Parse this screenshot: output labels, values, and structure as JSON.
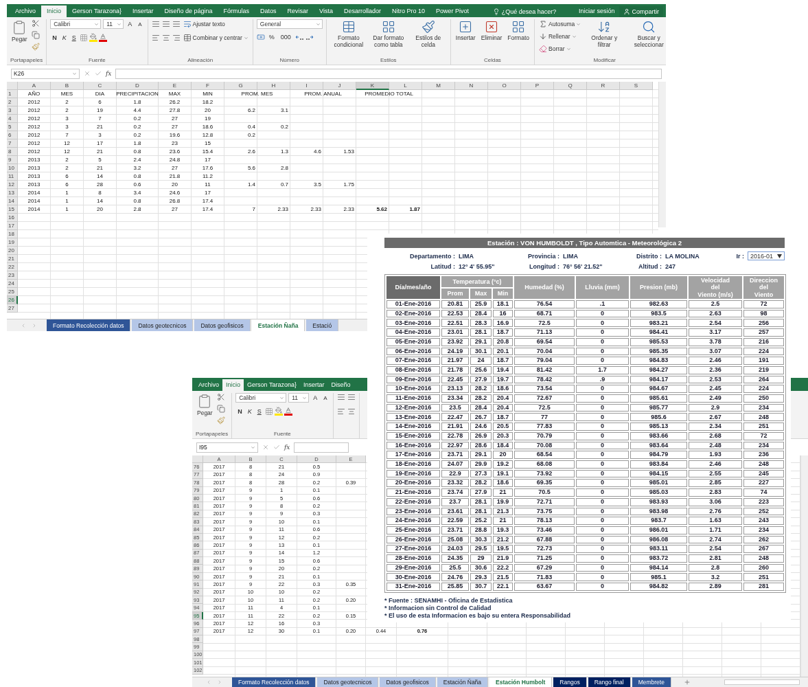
{
  "excel_window_top": {
    "ribbon_tabs": [
      {
        "label": "Archivo",
        "selected": false
      },
      {
        "label": "Inicio",
        "selected": true
      },
      {
        "label": "Gerson Tarazona}",
        "selected": false
      },
      {
        "label": "Insertar",
        "selected": false
      },
      {
        "label": "Diseño de página",
        "selected": false
      },
      {
        "label": "Fórmulas",
        "selected": false
      },
      {
        "label": "Datos",
        "selected": false
      },
      {
        "label": "Revisar",
        "selected": false
      },
      {
        "label": "Vista",
        "selected": false
      },
      {
        "label": "Desarrollador",
        "selected": false
      },
      {
        "label": "Nitro Pro 10",
        "selected": false
      },
      {
        "label": "Power Pivot",
        "selected": false
      }
    ],
    "tell_me": "¿Qué desea hacer?",
    "sign_in": "Iniciar sesión",
    "share": "Compartir",
    "ribbon": [
      {
        "kind": "clipboard",
        "name": "Portapapeles",
        "paste": "Pegar"
      },
      {
        "kind": "font",
        "name": "Fuente",
        "font": "Calibri",
        "size": "11",
        "grow": "A",
        "shrink": "A",
        "styles": [
          "N",
          "K",
          "S"
        ]
      },
      {
        "kind": "alignment",
        "name": "Alineación",
        "wrap": "Ajustar texto",
        "merge": "Combinar y centrar"
      },
      {
        "kind": "number",
        "name": "Número",
        "format": "General",
        "symbols": [
          "%",
          "000"
        ]
      },
      {
        "kind": "styles",
        "name": "Estilos",
        "buttons": [
          "Formato condicional",
          "Dar formato como tabla",
          "Estilos de celda"
        ]
      },
      {
        "kind": "cells",
        "name": "Celdas",
        "buttons": [
          "Insertar",
          "Eliminar",
          "Formato"
        ]
      },
      {
        "kind": "editing",
        "name": "Modificar",
        "small": [
          "Autosuma",
          "Rellenar",
          "Borrar"
        ],
        "large": [
          "Ordenar y filtrar",
          "Buscar y seleccionar"
        ]
      }
    ],
    "name_box": "K26",
    "formula_label": "fx",
    "columns": [
      {
        "label": "A",
        "selected": false
      },
      {
        "label": "B",
        "selected": false
      },
      {
        "label": "C",
        "selected": false
      },
      {
        "label": "D",
        "selected": false
      },
      {
        "label": "E",
        "selected": false
      },
      {
        "label": "F",
        "selected": false
      },
      {
        "label": "G",
        "selected": false
      },
      {
        "label": "H",
        "selected": false
      },
      {
        "label": "I",
        "selected": false
      },
      {
        "label": "J",
        "selected": false
      },
      {
        "label": "K",
        "selected": true
      },
      {
        "label": "L",
        "selected": false
      },
      {
        "label": "M",
        "selected": false
      },
      {
        "label": "N",
        "selected": false
      },
      {
        "label": "O",
        "selected": false
      },
      {
        "label": "P",
        "selected": false
      },
      {
        "label": "Q",
        "selected": false
      },
      {
        "label": "R",
        "selected": false
      },
      {
        "label": "S",
        "selected": false
      }
    ],
    "rows": [
      {
        "num": "1",
        "selected": false,
        "merged": true,
        "cells": [
          "AÑO",
          "MES",
          "DIA",
          "PRECIPITACION",
          "MAX",
          "MIN",
          "PROM. MES",
          null,
          "PROM. ANUAL",
          null,
          "PROMEDIO TOTAL"
        ]
      },
      {
        "num": "2",
        "selected": false,
        "cells": [
          "2012",
          "2",
          "6",
          "1.8",
          "26.2",
          "18.2"
        ]
      },
      {
        "num": "3",
        "selected": false,
        "cells": [
          "2012",
          "2",
          "19",
          "4.4",
          "27.8",
          "20",
          "6.2",
          "3.1"
        ]
      },
      {
        "num": "4",
        "selected": false,
        "cells": [
          "2012",
          "3",
          "7",
          "0.2",
          "27",
          "19"
        ]
      },
      {
        "num": "5",
        "selected": false,
        "cells": [
          "2012",
          "3",
          "21",
          "0.2",
          "27",
          "18.6",
          "0.4",
          "0.2"
        ]
      },
      {
        "num": "6",
        "selected": false,
        "cells": [
          "2012",
          "7",
          "3",
          "0.2",
          "19.6",
          "12.8",
          "0.2"
        ]
      },
      {
        "num": "7",
        "selected": false,
        "cells": [
          "2012",
          "12",
          "17",
          "1.8",
          "23",
          "15"
        ]
      },
      {
        "num": "8",
        "selected": false,
        "cells": [
          "2012",
          "12",
          "21",
          "0.8",
          "23.6",
          "15.4",
          "2.6",
          "1.3",
          "4.6",
          "1.53"
        ]
      },
      {
        "num": "9",
        "selected": false,
        "cells": [
          "2013",
          "2",
          "5",
          "2.4",
          "24.8",
          "17"
        ]
      },
      {
        "num": "10",
        "selected": false,
        "cells": [
          "2013",
          "2",
          "21",
          "3.2",
          "27",
          "17.6",
          "5.6",
          "2.8"
        ]
      },
      {
        "num": "11",
        "selected": false,
        "cells": [
          "2013",
          "6",
          "14",
          "0.8",
          "21.8",
          "11.2"
        ]
      },
      {
        "num": "12",
        "selected": false,
        "cells": [
          "2013",
          "6",
          "28",
          "0.6",
          "20",
          "11",
          "1.4",
          "0.7",
          "3.5",
          "1.75"
        ]
      },
      {
        "num": "13",
        "selected": false,
        "cells": [
          "2014",
          "1",
          "8",
          "3.4",
          "24.6",
          "17"
        ]
      },
      {
        "num": "14",
        "selected": false,
        "cells": [
          "2014",
          "1",
          "14",
          "0.8",
          "26.8",
          "17.4"
        ]
      },
      {
        "num": "15",
        "selected": false,
        "cells": [
          "2014",
          "1",
          "20",
          "2.8",
          "27",
          "17.4",
          "7",
          "2.33",
          "2.33",
          "2.33",
          {
            "text": "5.62",
            "bold": true
          },
          {
            "text": "1.87",
            "bold": true
          }
        ]
      },
      {
        "num": "16",
        "selected": false
      },
      {
        "num": "17",
        "selected": false
      },
      {
        "num": "18",
        "selected": false
      },
      {
        "num": "19",
        "selected": false
      },
      {
        "num": "20",
        "selected": false
      },
      {
        "num": "21",
        "selected": false
      },
      {
        "num": "22",
        "selected": false
      },
      {
        "num": "23",
        "selected": false
      },
      {
        "num": "24",
        "selected": false
      },
      {
        "num": "25",
        "selected": false
      },
      {
        "num": "26",
        "selected": true
      },
      {
        "num": "27",
        "selected": false
      }
    ],
    "sheet_tabs": [
      {
        "label": "Formato Recolección datos",
        "selected": false,
        "color": "#2f5597"
      },
      {
        "label": "Datos geotecnicos",
        "selected": false,
        "color": "#b4c6e7"
      },
      {
        "label": "Datos geofisicos",
        "selected": false,
        "color": "#b4c6e7"
      },
      {
        "label": "Estación Ñaña",
        "selected": true
      },
      {
        "label": "Estació",
        "selected": false,
        "color": "#b4c6e7"
      }
    ]
  },
  "station_report": {
    "title": "Estación : VON HUMBOLDT , Tipo Automtica - Meteorológica 2",
    "info": [
      [
        {
          "label": "Departamento :",
          "value": "LIMA"
        },
        {
          "label": "Provincia :",
          "value": "LIMA"
        },
        {
          "label": "Distrito :",
          "value": "LA MOLINA"
        }
      ],
      [
        {
          "label": "Latitud :",
          "value": "12° 4' 55.95\""
        },
        {
          "label": "Longitud :",
          "value": "76° 56' 21.52\""
        },
        {
          "label": "Altitud :",
          "value": "247"
        }
      ]
    ],
    "go_to": {
      "label": "Ir :",
      "value": "2016-01"
    },
    "columns": [
      {
        "label": "Día/mes/año"
      },
      {
        "label": "Temperatura (°c)",
        "colspan": 3,
        "sub": [
          "Prom",
          "Max",
          "Min"
        ]
      },
      {
        "label": "Humedad (%)"
      },
      {
        "label": "Lluvia (mm)"
      },
      {
        "label": "Presion (mb)"
      },
      {
        "label": "Velocidad\ndel\nViento (m/s)"
      },
      {
        "label": "Direccion\ndel\nViento"
      }
    ],
    "rows": [
      [
        "01-Ene-2016",
        "20.81",
        "25.9",
        "18.1",
        "76.54",
        ".1",
        "982.63",
        "2.5",
        "72"
      ],
      [
        "02-Ene-2016",
        "22.53",
        "28.4",
        "16",
        "68.71",
        "0",
        "983.5",
        "2.63",
        "98"
      ],
      [
        "03-Ene-2016",
        "22.51",
        "28.3",
        "16.9",
        "72.5",
        "0",
        "983.21",
        "2.54",
        "256"
      ],
      [
        "04-Ene-2016",
        "23.01",
        "28.1",
        "18.7",
        "71.13",
        "0",
        "984.41",
        "3.17",
        "257"
      ],
      [
        "05-Ene-2016",
        "23.92",
        "29.1",
        "20.8",
        "69.54",
        "0",
        "985.53",
        "3.78",
        "216"
      ],
      [
        "06-Ene-2016",
        "24.19",
        "30.1",
        "20.1",
        "70.04",
        "0",
        "985.35",
        "3.07",
        "224"
      ],
      [
        "07-Ene-2016",
        "21.97",
        "24",
        "18.7",
        "79.04",
        "0",
        "984.83",
        "2.46",
        "191"
      ],
      [
        "08-Ene-2016",
        "21.78",
        "25.6",
        "19.4",
        "81.42",
        "1.7",
        "984.27",
        "2.36",
        "219"
      ],
      [
        "09-Ene-2016",
        "22.45",
        "27.9",
        "19.7",
        "78.42",
        ".9",
        "984.17",
        "2.53",
        "264"
      ],
      [
        "10-Ene-2016",
        "23.13",
        "28.2",
        "18.6",
        "73.54",
        "0",
        "984.67",
        "2.45",
        "224"
      ],
      [
        "11-Ene-2016",
        "23.34",
        "28.2",
        "20.4",
        "72.67",
        "0",
        "985.61",
        "2.49",
        "250"
      ],
      [
        "12-Ene-2016",
        "23.5",
        "28.4",
        "20.4",
        "72.5",
        "0",
        "985.77",
        "2.9",
        "234"
      ],
      [
        "13-Ene-2016",
        "22.47",
        "26.7",
        "18.7",
        "77",
        "0",
        "985.6",
        "2.67",
        "248"
      ],
      [
        "14-Ene-2016",
        "21.91",
        "24.6",
        "20.5",
        "77.83",
        "0",
        "985.13",
        "2.34",
        "251"
      ],
      [
        "15-Ene-2016",
        "22.78",
        "26.9",
        "20.3",
        "70.79",
        "0",
        "983.66",
        "2.68",
        "72"
      ],
      [
        "16-Ene-2016",
        "22.97",
        "28.6",
        "18.4",
        "70.08",
        "0",
        "983.64",
        "2.48",
        "234"
      ],
      [
        "17-Ene-2016",
        "23.71",
        "29.1",
        "20",
        "68.54",
        "0",
        "984.79",
        "1.93",
        "236"
      ],
      [
        "18-Ene-2016",
        "24.07",
        "29.9",
        "19.2",
        "68.08",
        "0",
        "983.84",
        "2.46",
        "248"
      ],
      [
        "19-Ene-2016",
        "22.9",
        "27.3",
        "19.1",
        "73.92",
        "0",
        "984.15",
        "2.55",
        "245"
      ],
      [
        "20-Ene-2016",
        "23.32",
        "28.2",
        "18.6",
        "69.35",
        "0",
        "985.01",
        "2.85",
        "227"
      ],
      [
        "21-Ene-2016",
        "23.74",
        "27.9",
        "21",
        "70.5",
        "0",
        "985.03",
        "2.83",
        "74"
      ],
      [
        "22-Ene-2016",
        "23.7",
        "28.1",
        "19.9",
        "72.71",
        "0",
        "983.93",
        "3.06",
        "223"
      ],
      [
        "23-Ene-2016",
        "23.61",
        "28.1",
        "21.3",
        "73.75",
        "0",
        "983.98",
        "2.76",
        "252"
      ],
      [
        "24-Ene-2016",
        "22.59",
        "25.2",
        "21",
        "78.13",
        "0",
        "983.7",
        "1.63",
        "243"
      ],
      [
        "25-Ene-2016",
        "23.71",
        "28.8",
        "19.3",
        "73.46",
        "0",
        "986.01",
        "1.71",
        "234"
      ],
      [
        "26-Ene-2016",
        "25.08",
        "30.3",
        "21.2",
        "67.88",
        "0",
        "986.08",
        "2.74",
        "262"
      ],
      [
        "27-Ene-2016",
        "24.03",
        "29.5",
        "19.5",
        "72.73",
        "0",
        "983.11",
        "2.54",
        "267"
      ],
      [
        "28-Ene-2016",
        "24.35",
        "29",
        "21.9",
        "71.25",
        "0",
        "983.72",
        "2.81",
        "248"
      ],
      [
        "29-Ene-2016",
        "25.5",
        "30.6",
        "22.2",
        "67.29",
        "0",
        "984.14",
        "2.8",
        "260"
      ],
      [
        "30-Ene-2016",
        "24.76",
        "29.3",
        "21.5",
        "71.83",
        "0",
        "985.1",
        "3.2",
        "251"
      ],
      [
        "31-Ene-2016",
        "25.85",
        "30.7",
        "22.1",
        "63.67",
        "0",
        "984.82",
        "2.89",
        "281"
      ]
    ],
    "notes": [
      "* Fuente : SENAMHI - Oficina de Estadistica",
      "* Informacion sin Control de Calidad",
      "* El uso de esta Informacion es bajo su entera Responsabilidad"
    ]
  },
  "excel_window_bottom": {
    "ribbon_tabs": [
      {
        "label": "Archivo",
        "selected": false
      },
      {
        "label": "Inicio",
        "selected": true
      },
      {
        "label": "Gerson Tarazona}",
        "selected": false
      },
      {
        "label": "Insertar",
        "selected": false
      },
      {
        "label": "Diseño",
        "selected": false
      }
    ],
    "ribbon": [
      {
        "kind": "clipboard",
        "name": "Portapapeles",
        "paste": "Pegar"
      },
      {
        "kind": "font",
        "name": "Fuente",
        "font": "Calibri",
        "size": "11",
        "grow": "A",
        "shrink": "A",
        "styles": [
          "N",
          "K",
          "S"
        ]
      },
      {
        "kind": "align_icons"
      }
    ],
    "name_box": "I95",
    "formula_label": "fx",
    "columns": [
      {
        "label": "A",
        "selected": false
      },
      {
        "label": "B",
        "selected": false
      },
      {
        "label": "C",
        "selected": false
      },
      {
        "label": "D",
        "selected": false
      },
      {
        "label": "E",
        "selected": false
      }
    ],
    "rows": [
      {
        "num": "76",
        "selected": false,
        "cells": [
          "2017",
          "8",
          "21",
          "0.5"
        ]
      },
      {
        "num": "77",
        "selected": false,
        "cells": [
          "2017",
          "8",
          "24",
          "0.9"
        ]
      },
      {
        "num": "78",
        "selected": false,
        "cells": [
          "2017",
          "8",
          "28",
          "0.2",
          "0.39"
        ]
      },
      {
        "num": "79",
        "selected": false,
        "cells": [
          "2017",
          "9",
          "1",
          "0.1"
        ]
      },
      {
        "num": "80",
        "selected": false,
        "cells": [
          "2017",
          "9",
          "5",
          "0.6"
        ]
      },
      {
        "num": "81",
        "selected": false,
        "cells": [
          "2017",
          "9",
          "8",
          "0.2"
        ]
      },
      {
        "num": "82",
        "selected": false,
        "cells": [
          "2017",
          "9",
          "9",
          "0.3"
        ]
      },
      {
        "num": "83",
        "selected": false,
        "cells": [
          "2017",
          "9",
          "10",
          "0.1"
        ]
      },
      {
        "num": "84",
        "selected": false,
        "cells": [
          "2017",
          "9",
          "11",
          "0.6"
        ]
      },
      {
        "num": "85",
        "selected": false,
        "cells": [
          "2017",
          "9",
          "12",
          "0.2"
        ]
      },
      {
        "num": "86",
        "selected": false,
        "cells": [
          "2017",
          "9",
          "13",
          "0.1"
        ]
      },
      {
        "num": "87",
        "selected": false,
        "cells": [
          "2017",
          "9",
          "14",
          "1.2"
        ]
      },
      {
        "num": "88",
        "selected": false,
        "cells": [
          "2017",
          "9",
          "15",
          "0.6"
        ]
      },
      {
        "num": "89",
        "selected": false,
        "cells": [
          "2017",
          "9",
          "20",
          "0.2"
        ]
      },
      {
        "num": "90",
        "selected": false,
        "cells": [
          "2017",
          "9",
          "21",
          "0.1"
        ]
      },
      {
        "num": "91",
        "selected": false,
        "cells": [
          "2017",
          "9",
          "22",
          "0.3",
          "0.35"
        ]
      },
      {
        "num": "92",
        "selected": false,
        "cells": [
          "2017",
          "10",
          "10",
          "0.2"
        ]
      },
      {
        "num": "93",
        "selected": false,
        "cells": [
          "2017",
          "10",
          "11",
          "0.2",
          "0.20"
        ]
      },
      {
        "num": "94",
        "selected": false,
        "cells": [
          "2017",
          "11",
          "4",
          "0.1"
        ]
      },
      {
        "num": "95",
        "selected": true,
        "cells": [
          "2017",
          "11",
          "22",
          "0.2",
          "0.15"
        ]
      },
      {
        "num": "96",
        "selected": false,
        "cells": [
          "2017",
          "12",
          "16",
          "0.3"
        ]
      },
      {
        "num": "97",
        "selected": false,
        "cells": [
          "2017",
          "12",
          "30",
          "0.1",
          "0.20",
          "0.44",
          {
            "text": "0.76",
            "bold": true
          }
        ]
      },
      {
        "num": "98",
        "selected": false
      },
      {
        "num": "99",
        "selected": false
      },
      {
        "num": "100",
        "selected": false
      },
      {
        "num": "101",
        "selected": false
      },
      {
        "num": "102",
        "selected": false
      }
    ],
    "sheet_tabs": [
      {
        "label": "Formato Recolección datos",
        "selected": false,
        "color": "#2f5597"
      },
      {
        "label": "Datos geotecnicos",
        "selected": false,
        "color": "#b4c6e7"
      },
      {
        "label": "Datos geofisicos",
        "selected": false,
        "color": "#b4c6e7"
      },
      {
        "label": "Estación Ñaña",
        "selected": false,
        "color": "#b4c6e7"
      },
      {
        "label": "Estación Humbolt",
        "selected": true
      },
      {
        "label": "Rangos",
        "selected": false,
        "color": "#002060"
      },
      {
        "label": "Rango final",
        "selected": false,
        "color": "#002060"
      },
      {
        "label": "Membrete",
        "selected": false,
        "color": "#2f5597"
      }
    ]
  }
}
